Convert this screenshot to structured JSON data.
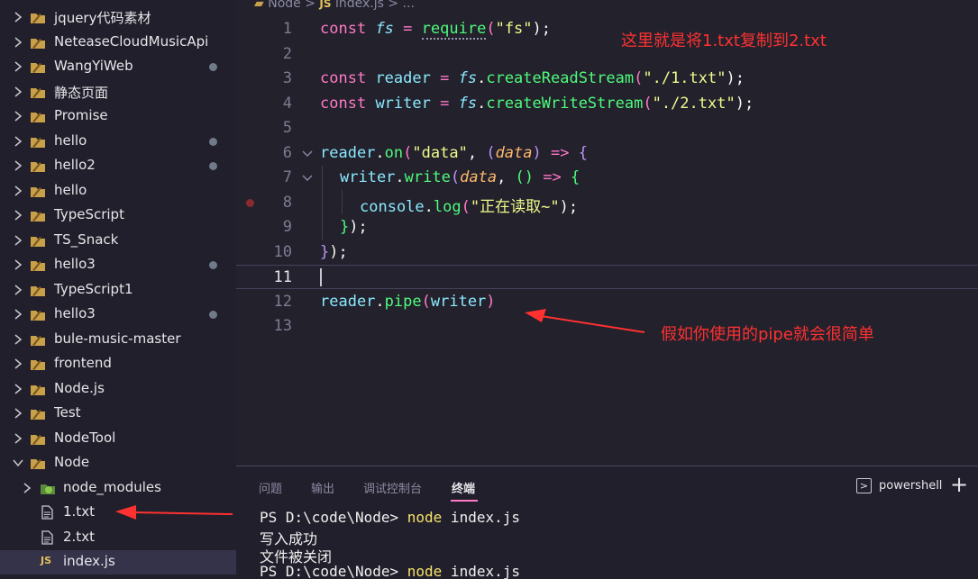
{
  "explorer": {
    "items": [
      {
        "label": "jquery代码素材",
        "dot": false
      },
      {
        "label": "NeteaseCloudMusicApi",
        "dot": false
      },
      {
        "label": "WangYiWeb",
        "dot": true
      },
      {
        "label": "静态页面",
        "dot": false
      },
      {
        "label": "Promise",
        "dot": false
      },
      {
        "label": "hello",
        "dot": true
      },
      {
        "label": "hello2",
        "dot": true
      },
      {
        "label": "hello",
        "dot": false
      },
      {
        "label": "TypeScript",
        "dot": false
      },
      {
        "label": "TS_Snack",
        "dot": false
      },
      {
        "label": "hello3",
        "dot": true
      },
      {
        "label": "TypeScript1",
        "dot": false
      },
      {
        "label": "hello3",
        "dot": true
      },
      {
        "label": "bule-music-master",
        "dot": false
      },
      {
        "label": "frontend",
        "dot": false
      },
      {
        "label": "Node.js",
        "dot": false
      },
      {
        "label": "Test",
        "dot": false
      },
      {
        "label": "NodeTool",
        "dot": false
      },
      {
        "label": "Node",
        "dot": false,
        "expanded": true
      }
    ],
    "node_children": [
      {
        "label": "node_modules",
        "kind": "folder"
      },
      {
        "label": "1.txt",
        "kind": "file"
      },
      {
        "label": "2.txt",
        "kind": "file"
      },
      {
        "label": "index.js",
        "kind": "js",
        "selected": true
      }
    ],
    "js_badge": "JS"
  },
  "editor": {
    "breadcrumb": {
      "folder": "Node",
      "sep": ">",
      "js_badge": "JS",
      "file": "index.js",
      "tail": "> ..."
    },
    "line_numbers": [
      "1",
      "2",
      "3",
      "4",
      "5",
      "6",
      "7",
      "8",
      "9",
      "10",
      "11",
      "12",
      "13"
    ],
    "active_line": "11",
    "code": {
      "l1": {
        "kw": "const",
        "name": "fs",
        "eq": "=",
        "call": "require",
        "open": "(",
        "arg": "\"fs\"",
        "close": ");"
      },
      "l3": {
        "kw": "const",
        "name": "reader",
        "eq": "=",
        "obj": "fs",
        "dot": ".",
        "method": "createReadStream",
        "open": "(",
        "arg": "\"./1.txt\"",
        "close": ");"
      },
      "l4": {
        "kw": "const",
        "name": "writer",
        "eq": "=",
        "obj": "fs",
        "dot": ".",
        "method": "createWriteStream",
        "open": "(",
        "arg": "\"./2.txt\"",
        "close": ");"
      },
      "l6": {
        "obj": "reader",
        "dot": ".",
        "method": "on",
        "open": "(",
        "arg": "\"data\"",
        "comma": ", ",
        "popen": "(",
        "param": "data",
        "pclose": ")",
        "arrow": " => ",
        "brace": "{"
      },
      "l7": {
        "obj": "writer",
        "dot": ".",
        "method": "write",
        "open": "(",
        "param": "data",
        "comma": ", ",
        "parens": "()",
        "arrow": " => ",
        "brace": "{"
      },
      "l8": {
        "obj": "console",
        "dot": ".",
        "method": "log",
        "open": "(",
        "arg": "\"正在读取~\"",
        "close": ");"
      },
      "l9": {
        "brace": "}",
        "close": ");"
      },
      "l10": {
        "brace": "}",
        "close": ");"
      },
      "l12": {
        "obj": "reader",
        "dot": ".",
        "method": "pipe",
        "open": "(",
        "arg": "writer",
        "close": ")"
      }
    },
    "annotations": {
      "top": "这里就是将1.txt复制到2.txt",
      "pipe": "假如你使用的pipe就会很简单"
    }
  },
  "panel": {
    "tabs": [
      "问题",
      "输出",
      "调试控制台",
      "终端"
    ],
    "active_tab": "终端",
    "shell": "powershell",
    "shell_icon": ">",
    "add_icon": "+",
    "terminal": [
      {
        "prompt": "PS D:\\code\\Node> ",
        "cmd": "node",
        "rest": " index.js"
      },
      {
        "text": "写入成功"
      },
      {
        "text": "文件被关闭"
      },
      {
        "prompt": "PS D:\\code\\Node> ",
        "cmd": "node",
        "rest": " index.js"
      }
    ]
  },
  "colors": {
    "annotation_red": "#ff3131",
    "keyword": "#ff79c6",
    "function": "#50fa7b",
    "string": "#f1fa8c",
    "variable": "#8be9fd"
  }
}
